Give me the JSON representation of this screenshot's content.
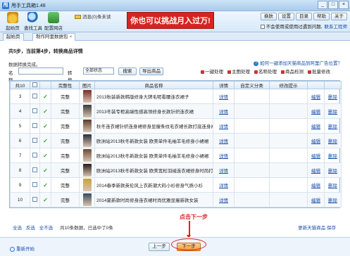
{
  "window": {
    "title": "甩手工具箱1.48",
    "controls": [
      "_",
      "□",
      "×"
    ]
  },
  "toolbar": {
    "items": [
      {
        "label": "起始页",
        "icon": "home-icon"
      },
      {
        "label": "查找工具",
        "icon": "search-icon"
      },
      {
        "label": "配置网店",
        "icon": "shop-icon"
      }
    ],
    "message": "消息(0)条未读",
    "banner": "你也可以挑战月入过万!",
    "right_buttons": [
      "换肤",
      "设置",
      "目录",
      "帮助",
      "关于"
    ],
    "right_buttons2": [
      "论坛",
      "官网"
    ],
    "check_option": "不会使用或使用过遇到问题,",
    "check_link": "联系工程师"
  },
  "tabs": [
    {
      "label": "起始页"
    },
    {
      "label": "制作阿里数据包",
      "close": "×"
    }
  ],
  "step": "共5步，当前第4步，转换商品详情",
  "status": "数据转换完成。",
  "filters": {
    "name_label": "名称",
    "status_label": "转换状态",
    "status_value": "全部状态",
    "search_btn": "搜索",
    "export_btn": "导出商品"
  },
  "help_link": "如何一键添加天猫商品到阿里广告位置？",
  "actions": [
    "一键处理",
    "主图处理",
    "名称处理",
    "商品检测",
    "批量修改"
  ],
  "grid": {
    "headers": [
      "共10",
      "",
      "",
      "完整性",
      "图片",
      "商品名称",
      "详情",
      "自定义分类",
      "修改提示",
      "",
      ""
    ],
    "rows": [
      {
        "num": "3",
        "status": "完整",
        "name": "2013秋装新款韩版修身大牌毛呢看腰连衣裙子",
        "detail": "详情",
        "edit": "编辑",
        "del": "删除"
      },
      {
        "num": "4",
        "status": "完整",
        "name": "2013冬装专柜高端性感高领修身长款针织连衣裙",
        "detail": "详情",
        "edit": "编辑",
        "del": "删除"
      },
      {
        "num": "5",
        "status": "完整",
        "name": "秋冬连衣裙针织连身裙修身显瘦条纹毛衣裙长款打底连身裙",
        "detail": "详情",
        "edit": "编辑",
        "del": "删除"
      },
      {
        "num": "6",
        "status": "完整",
        "name": "欧洲站2013秋冬新款女装 欧美单件毛袖羊毛修身小裙裙",
        "detail": "详情",
        "edit": "编辑",
        "del": "删除"
      },
      {
        "num": "7",
        "status": "完整",
        "name": "欧洲站2013秋冬新款女装 欧美单件毛袖羊毛修身小裙裙",
        "detail": "详情",
        "edit": "编辑",
        "del": "删除"
      },
      {
        "num": "8",
        "status": "完整",
        "name": "欧洲站2013秋冬新款女装 欧美宽松羽绒连衣裙修身时尚打底衫",
        "detail": "详情",
        "edit": "编辑",
        "del": "删除"
      },
      {
        "num": "9",
        "status": "完整",
        "name": "2014春季新款英伦风上衣新潮大码小衫修身气质小衫",
        "detail": "详情",
        "edit": "编辑",
        "del": "删除"
      },
      {
        "num": "10",
        "status": "完整",
        "name": "2014夏新款时尚修身连衣裙时尚优雅显瘦新款女装",
        "detail": "详情",
        "edit": "编辑",
        "del": "删除"
      }
    ]
  },
  "bottom": {
    "select_all": "全选",
    "invert": "反选",
    "select_none": "全不选",
    "info": "共10条数据，已选中了0条",
    "right_link1": "更新天猫商品",
    "right_link2": "保存"
  },
  "callout": "点击下一步",
  "footer": {
    "restart": "重新开始",
    "prev": "上一步",
    "next": "下一步"
  },
  "colors": {
    "banner": "#d6241e",
    "accent": "#2a7ad2",
    "callout": "#dd2222"
  }
}
